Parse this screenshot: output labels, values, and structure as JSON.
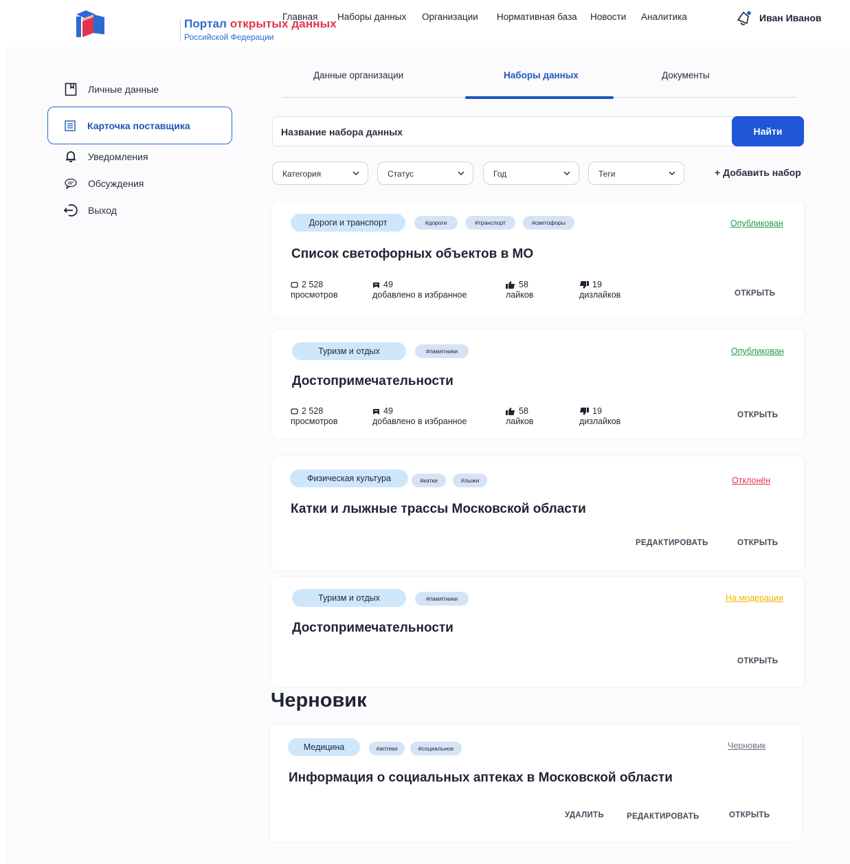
{
  "header": {
    "logo_title_part1": "Портал",
    "logo_title_part2": "открытых данных",
    "logo_subtitle": "Российской Федерации",
    "nav": [
      "Главная",
      "Наборы данных",
      "Организации",
      "Нормативная база",
      "Новости",
      "Аналитика"
    ],
    "user_name": "Иван Иванов"
  },
  "sidebar": {
    "items": [
      {
        "label": "Личные данные",
        "icon": "bookmark-icon"
      },
      {
        "label": "Карточка поставщика",
        "icon": "card-list-icon",
        "active": true
      },
      {
        "label": "Уведомления",
        "icon": "bell-icon"
      },
      {
        "label": "Обсуждения",
        "icon": "chat-bubble-icon"
      },
      {
        "label": "Выход",
        "icon": "logout-icon"
      }
    ]
  },
  "tabs": [
    "Данные организации",
    "Наборы данных",
    "Документы"
  ],
  "search": {
    "placeholder": "Название набора данных",
    "button": "Найти"
  },
  "filters": [
    "Категория",
    "Статус",
    "Год",
    "Теги"
  ],
  "add_dataset": "+ Добавить набор",
  "draft_section_title": "Черновик",
  "colors": {
    "accent": "#1f57d6",
    "published": "#1f9a4a",
    "rejected": "#e0364a",
    "moderation": "#f2b600",
    "draft": "#6b7080"
  },
  "cards": [
    {
      "category": "Дороги и транспорт",
      "tags": [
        "#дороги",
        "#транспорт",
        "#светофоры"
      ],
      "status": "Опубликован",
      "title": "Список светофорных объектов в МО",
      "stats": {
        "views": "2 528",
        "views_label": "просмотров",
        "fav": "49",
        "fav_label": "добавлено в избранное",
        "likes": "58",
        "likes_label": "лайков",
        "dislikes": "19",
        "dislikes_label": "дизлайков"
      },
      "actions": [
        "ОТКРЫТЬ"
      ]
    },
    {
      "category": "Туризм и отдых",
      "tags": [
        "#памятники"
      ],
      "status": "Опубликован",
      "title": "Достопримечательности",
      "stats": {
        "views": "2 528",
        "views_label": "просмотров",
        "fav": "49",
        "fav_label": "добавлено в избранное",
        "likes": "58",
        "likes_label": "лайков",
        "dislikes": "19",
        "dislikes_label": "дизлайков"
      },
      "actions": [
        "ОТКРЫТЬ"
      ]
    },
    {
      "category": "Физическая культура",
      "tags": [
        "#катки",
        "#лыжи"
      ],
      "status": "Отклонён",
      "title": "Катки и лыжные трассы Московской области",
      "actions": [
        "РЕДАКТИРОВАТЬ",
        "ОТКРЫТЬ"
      ]
    },
    {
      "category": "Туризм и отдых",
      "tags": [
        "#памятники"
      ],
      "status": "На модерации",
      "title": "Достопримечательности",
      "actions": [
        "ОТКРЫТЬ"
      ]
    },
    {
      "category": "Медицина",
      "tags": [
        "#аптеки",
        "#социальное"
      ],
      "status": "Черновик",
      "title": "Информация о социальных аптеках  в Московской области",
      "actions": [
        "УДАЛИТЬ",
        "РЕДАКТИРОВАТЬ",
        "ОТКРЫТЬ"
      ]
    }
  ]
}
